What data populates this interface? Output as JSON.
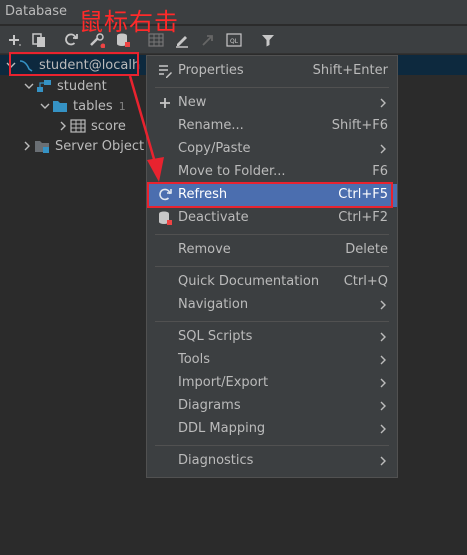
{
  "panel": {
    "title": "Database"
  },
  "annotation": {
    "text": "鼠标右击"
  },
  "tree": {
    "connection": "student@localh",
    "schema": "student",
    "tables_label": "tables",
    "tables_count": "1",
    "table_name": "score",
    "server_objects": "Server Object"
  },
  "menu": {
    "items": [
      {
        "label": "Properties",
        "shortcut": "Shift+Enter"
      },
      {
        "label": "New",
        "shortcut": ""
      },
      {
        "label": "Rename...",
        "shortcut": "Shift+F6"
      },
      {
        "label": "Copy/Paste",
        "shortcut": ""
      },
      {
        "label": "Move to Folder...",
        "shortcut": "F6"
      },
      {
        "label": "Refresh",
        "shortcut": "Ctrl+F5"
      },
      {
        "label": "Deactivate",
        "shortcut": "Ctrl+F2"
      },
      {
        "label": "Remove",
        "shortcut": "Delete"
      },
      {
        "label": "Quick Documentation",
        "shortcut": "Ctrl+Q"
      },
      {
        "label": "Navigation",
        "shortcut": ""
      },
      {
        "label": "SQL Scripts",
        "shortcut": ""
      },
      {
        "label": "Tools",
        "shortcut": ""
      },
      {
        "label": "Import/Export",
        "shortcut": ""
      },
      {
        "label": "Diagrams",
        "shortcut": ""
      },
      {
        "label": "DDL Mapping",
        "shortcut": ""
      },
      {
        "label": "Diagnostics",
        "shortcut": ""
      }
    ]
  },
  "colors": {
    "background": "#2b2b2b",
    "menu_background": "#3c3f41",
    "highlight": "#4b6eaf",
    "annotation_red": "#e8232f",
    "folder_blue": "#3592c4"
  },
  "icons": [
    "plus-icon",
    "copy-icon",
    "refresh-icon",
    "settings-icon",
    "database-icon",
    "table-icon",
    "edit-icon",
    "jump-icon",
    "query-console-icon",
    "filter-icon"
  ]
}
